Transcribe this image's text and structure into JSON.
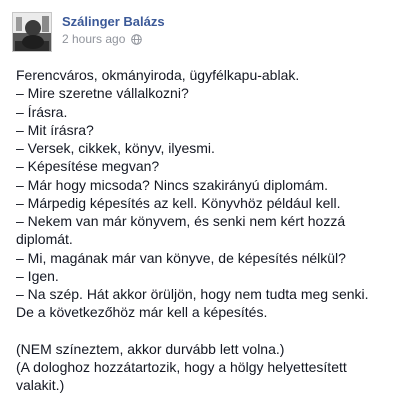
{
  "post": {
    "author": "Szálinger Balázs",
    "timestamp": "2 hours ago",
    "privacy_icon": "globe-icon",
    "lines": [
      "Ferencváros, okmányiroda, ügyfélkapu-ablak.",
      "– Mire szeretne vállalkozni?",
      "– Írásra.",
      "– Mit írásra?",
      "– Versek, cikkek, könyv, ilyesmi.",
      "– Képesítése megvan?",
      "– Már hogy micsoda? Nincs szakirányú diplomám.",
      "– Márpedig képesítés az kell. Könyvhöz például kell.",
      "– Nekem van már könyvem, és senki nem kért hozzá",
      "diplomát.",
      "– Mi, magának már van könyve, de képesítés nélkül?",
      "– Igen.",
      "– Na szép. Hát akkor örüljön, hogy nem tudta meg senki.",
      "De a következőhöz már kell a képesítés.",
      "",
      "(NEM színeztem, akkor durvább lett volna.)",
      "(A dologhoz hozzátartozik, hogy a hölgy helyettesített",
      "valakit.)"
    ]
  },
  "colors": {
    "author_link": "#3b5998",
    "meta_text": "#90949c",
    "body_text": "#141823"
  }
}
